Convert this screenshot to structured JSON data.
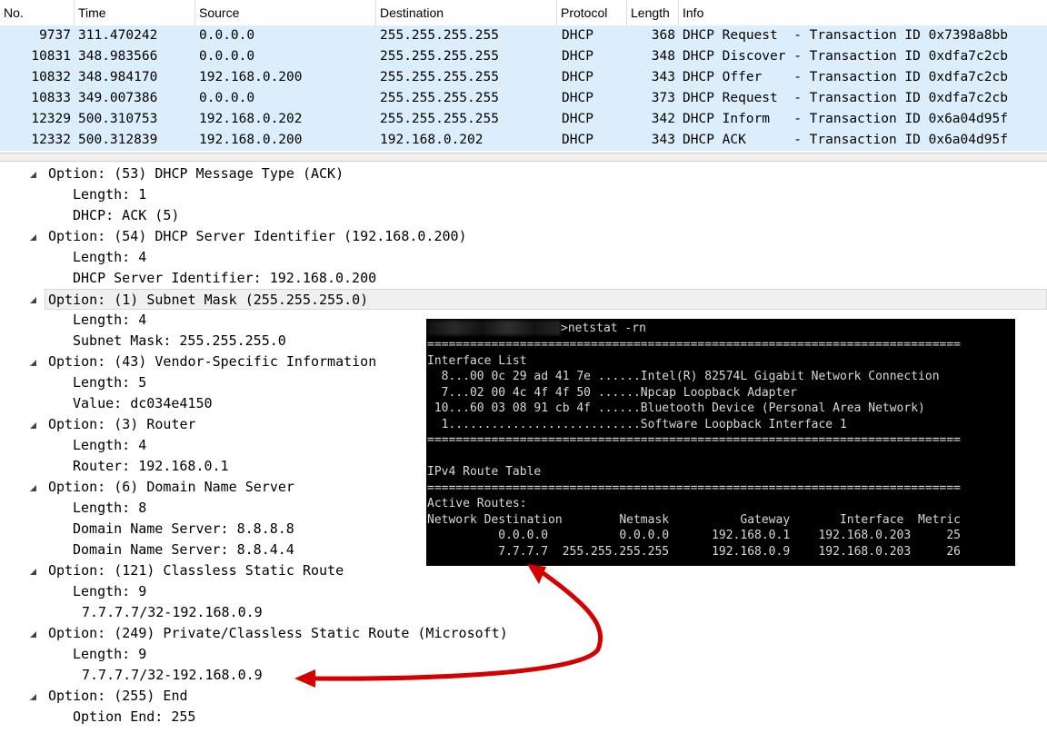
{
  "packet_list": {
    "columns": [
      "No.",
      "Time",
      "Source",
      "Destination",
      "Protocol",
      "Length",
      "Info"
    ],
    "rows": [
      {
        "no": "9737",
        "time": "311.470242",
        "source": "0.0.0.0",
        "destination": "255.255.255.255",
        "protocol": "DHCP",
        "length": "368",
        "info": "DHCP Request  - Transaction ID 0x7398a8bb"
      },
      {
        "no": "10831",
        "time": "348.983566",
        "source": "0.0.0.0",
        "destination": "255.255.255.255",
        "protocol": "DHCP",
        "length": "348",
        "info": "DHCP Discover - Transaction ID 0xdfa7c2cb"
      },
      {
        "no": "10832",
        "time": "348.984170",
        "source": "192.168.0.200",
        "destination": "255.255.255.255",
        "protocol": "DHCP",
        "length": "343",
        "info": "DHCP Offer    - Transaction ID 0xdfa7c2cb"
      },
      {
        "no": "10833",
        "time": "349.007386",
        "source": "0.0.0.0",
        "destination": "255.255.255.255",
        "protocol": "DHCP",
        "length": "373",
        "info": "DHCP Request  - Transaction ID 0xdfa7c2cb"
      },
      {
        "no": "12329",
        "time": "500.310753",
        "source": "192.168.0.202",
        "destination": "255.255.255.255",
        "protocol": "DHCP",
        "length": "342",
        "info": "DHCP Inform   - Transaction ID 0x6a04d95f"
      },
      {
        "no": "12332",
        "time": "500.312839",
        "source": "192.168.0.200",
        "destination": "192.168.0.202",
        "protocol": "DHCP",
        "length": "343",
        "info": "DHCP ACK      - Transaction ID 0x6a04d95f"
      }
    ]
  },
  "detail_tree": {
    "lines": [
      {
        "text": "Option: (53) DHCP Message Type (ACK)",
        "level": 0,
        "expandable": true
      },
      {
        "text": "Length: 1",
        "level": 1
      },
      {
        "text": "DHCP: ACK (5)",
        "level": 1
      },
      {
        "text": "Option: (54) DHCP Server Identifier (192.168.0.200)",
        "level": 0,
        "expandable": true
      },
      {
        "text": "Length: 4",
        "level": 1
      },
      {
        "text": "DHCP Server Identifier: 192.168.0.200",
        "level": 1
      },
      {
        "text": "Option: (1) Subnet Mask (255.255.255.0)",
        "level": 0,
        "expandable": true,
        "selected": true
      },
      {
        "text": "Length: 4",
        "level": 1
      },
      {
        "text": "Subnet Mask: 255.255.255.0",
        "level": 1
      },
      {
        "text": "Option: (43) Vendor-Specific Information",
        "level": 0,
        "expandable": true
      },
      {
        "text": "Length: 5",
        "level": 1
      },
      {
        "text": "Value: dc034e4150",
        "level": 1
      },
      {
        "text": "Option: (3) Router",
        "level": 0,
        "expandable": true
      },
      {
        "text": "Length: 4",
        "level": 1
      },
      {
        "text": "Router: 192.168.0.1",
        "level": 1
      },
      {
        "text": "Option: (6) Domain Name Server",
        "level": 0,
        "expandable": true
      },
      {
        "text": "Length: 8",
        "level": 1
      },
      {
        "text": "Domain Name Server: 8.8.8.8",
        "level": 1
      },
      {
        "text": "Domain Name Server: 8.8.4.4",
        "level": 1
      },
      {
        "text": "Option: (121) Classless Static Route",
        "level": 0,
        "expandable": true
      },
      {
        "text": "Length: 9",
        "level": 1
      },
      {
        "text": "7.7.7.7/32-192.168.0.9",
        "level": 2
      },
      {
        "text": "Option: (249) Private/Classless Static Route (Microsoft)",
        "level": 0,
        "expandable": true
      },
      {
        "text": "Length: 9",
        "level": 1
      },
      {
        "text": "7.7.7.7/32-192.168.0.9",
        "level": 2
      },
      {
        "text": "Option: (255) End",
        "level": 0,
        "expandable": true
      },
      {
        "text": "Option End: 255",
        "level": 1
      }
    ]
  },
  "terminal": {
    "command": ">netstat -rn",
    "lines": [
      "===========================================================================",
      "Interface List",
      "  8...00 0c 29 ad 41 7e ......Intel(R) 82574L Gigabit Network Connection",
      "  7...02 00 4c 4f 4f 50 ......Npcap Loopback Adapter",
      " 10...60 03 08 91 cb 4f ......Bluetooth Device (Personal Area Network)",
      "  1...........................Software Loopback Interface 1",
      "===========================================================================",
      "",
      "IPv4 Route Table",
      "===========================================================================",
      "Active Routes:",
      "Network Destination        Netmask          Gateway       Interface  Metric",
      "          0.0.0.0          0.0.0.0      192.168.0.1    192.168.0.203     25",
      "          7.7.7.7  255.255.255.255      192.168.0.9    192.168.0.203     26"
    ]
  },
  "colors": {
    "row_highlight": "#dcedfc",
    "terminal_bg": "#000000",
    "terminal_text": "#d8d8d8",
    "arrow": "#d40000"
  }
}
